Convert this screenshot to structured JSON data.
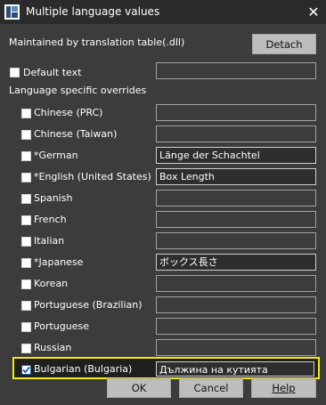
{
  "window": {
    "title": "Multiple language values",
    "close_icon": "close-icon",
    "app_icon": "app-logo-icon"
  },
  "header": {
    "maintained_label": "Maintained by translation table(.dll)",
    "detach_label": "Detach"
  },
  "default_text": {
    "label": "Default text",
    "value": "",
    "checked": false
  },
  "overrides_heading": "Language specific overrides",
  "languages": [
    {
      "label": "Chinese (PRC)",
      "value": "",
      "checked": false
    },
    {
      "label": "Chinese (Taiwan)",
      "value": "",
      "checked": false
    },
    {
      "label": "*German",
      "value": "Länge der Schachtel",
      "checked": false
    },
    {
      "label": "*English (United States)",
      "value": "Box Length",
      "checked": false
    },
    {
      "label": "Spanish",
      "value": "",
      "checked": false
    },
    {
      "label": "French",
      "value": "",
      "checked": false
    },
    {
      "label": "Italian",
      "value": "",
      "checked": false
    },
    {
      "label": "*Japanese",
      "value": "ボックス長さ",
      "checked": false
    },
    {
      "label": "Korean",
      "value": "",
      "checked": false
    },
    {
      "label": "Portuguese (Brazilian)",
      "value": "",
      "checked": false
    },
    {
      "label": "Portuguese",
      "value": "",
      "checked": false
    },
    {
      "label": "Russian",
      "value": "",
      "checked": false
    },
    {
      "label": "Bulgarian (Bulgaria)",
      "value": "Дължина на кутията",
      "checked": true
    }
  ],
  "buttons": {
    "ok": "OK",
    "cancel": "Cancel",
    "help": "Help"
  },
  "colors": {
    "background": "#3c3c3c",
    "titlebar": "#2b2b2b",
    "highlight": "#f6ea00",
    "button": "#bdbdbd"
  }
}
